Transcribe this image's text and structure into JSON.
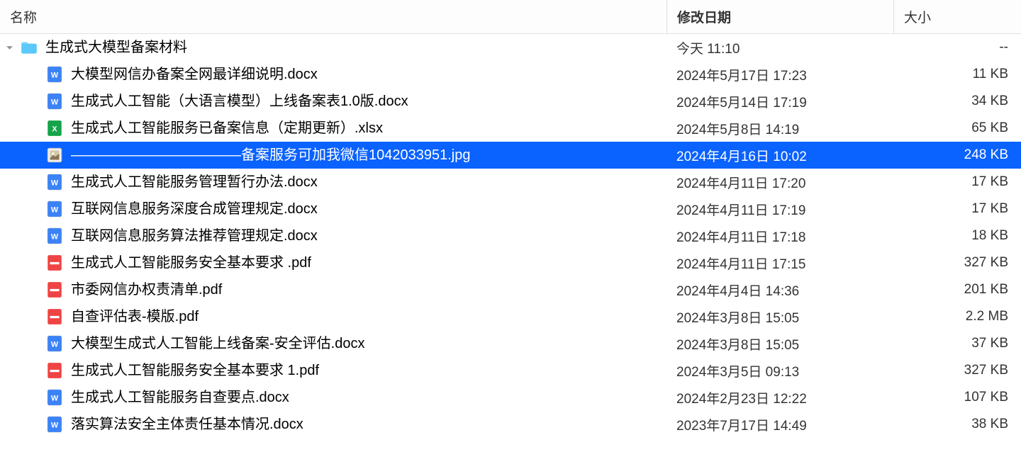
{
  "columns": {
    "name": "名称",
    "date_modified": "修改日期",
    "size": "大小"
  },
  "folder": {
    "name": "生成式大模型备案材料",
    "date": "今天 11:10",
    "size": "--",
    "icon": "folder"
  },
  "files": [
    {
      "name": "大模型网信办备案全网最详细说明.docx",
      "date": "2024年5月17日 17:23",
      "size": "11 KB",
      "icon": "docx",
      "selected": false
    },
    {
      "name": "生成式人工智能（大语言模型）上线备案表1.0版.docx",
      "date": "2024年5月14日 17:19",
      "size": "34 KB",
      "icon": "docx",
      "selected": false
    },
    {
      "name": "生成式人工智能服务已备案信息（定期更新）.xlsx",
      "date": "2024年5月8日 14:19",
      "size": "65 KB",
      "icon": "xlsx",
      "selected": false
    },
    {
      "name": "————————————备案服务可加我微信1042033951.jpg",
      "date": "2024年4月16日 10:02",
      "size": "248 KB",
      "icon": "jpg",
      "selected": true
    },
    {
      "name": "生成式人工智能服务管理暂行办法.docx",
      "date": "2024年4月11日 17:20",
      "size": "17 KB",
      "icon": "docx",
      "selected": false
    },
    {
      "name": "互联网信息服务深度合成管理规定.docx",
      "date": "2024年4月11日 17:19",
      "size": "17 KB",
      "icon": "docx",
      "selected": false
    },
    {
      "name": "互联网信息服务算法推荐管理规定.docx",
      "date": "2024年4月11日 17:18",
      "size": "18 KB",
      "icon": "docx",
      "selected": false
    },
    {
      "name": "生成式人工智能服务安全基本要求 .pdf",
      "date": "2024年4月11日 17:15",
      "size": "327 KB",
      "icon": "pdf",
      "selected": false
    },
    {
      "name": "市委网信办权责清单.pdf",
      "date": "2024年4月4日 14:36",
      "size": "201 KB",
      "icon": "pdf",
      "selected": false
    },
    {
      "name": "自查评估表-模版.pdf",
      "date": "2024年3月8日 15:05",
      "size": "2.2 MB",
      "icon": "pdf",
      "selected": false
    },
    {
      "name": "大模型生成式人工智能上线备案-安全评估.docx",
      "date": "2024年3月8日 15:05",
      "size": "37 KB",
      "icon": "docx",
      "selected": false
    },
    {
      "name": "生成式人工智能服务安全基本要求  1.pdf",
      "date": "2024年3月5日 09:13",
      "size": "327 KB",
      "icon": "pdf",
      "selected": false
    },
    {
      "name": "生成式人工智能服务自查要点.docx",
      "date": "2024年2月23日 12:22",
      "size": "107 KB",
      "icon": "docx",
      "selected": false
    },
    {
      "name": "落实算法安全主体责任基本情况.docx",
      "date": "2023年7月17日 14:49",
      "size": "38 KB",
      "icon": "docx",
      "selected": false
    }
  ]
}
